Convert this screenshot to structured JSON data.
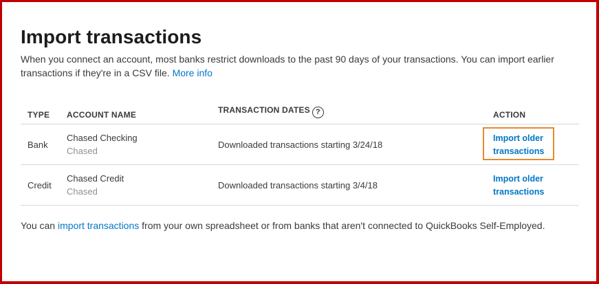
{
  "page": {
    "title": "Import transactions",
    "intro_text": "When you connect an account, most banks restrict downloads to the past 90 days of your transactions. You can import earlier transactions if they're in a CSV file.",
    "more_info_link": "More info"
  },
  "table": {
    "headers": {
      "type": "TYPE",
      "account_name": "ACCOUNT NAME",
      "transaction_dates": "TRANSACTION DATES",
      "action": "ACTION"
    },
    "help_icon_glyph": "?",
    "rows": [
      {
        "type": "Bank",
        "account_name": "Chased Checking",
        "account_institution": "Chased",
        "dates": "Downloaded transactions starting 3/24/18",
        "action_label": "Import older transactions"
      },
      {
        "type": "Credit",
        "account_name": "Chased Credit",
        "account_institution": "Chased",
        "dates": "Downloaded transactions starting 3/4/18",
        "action_label": "Import older transactions"
      }
    ]
  },
  "footer": {
    "prefix": "You can",
    "link": "import transactions",
    "suffix": "from your own spreadsheet or from banks that aren't connected to QuickBooks Self-Employed."
  },
  "colors": {
    "link": "#0077c5",
    "frame_border": "#c00000",
    "highlight_border": "#e58a2e"
  },
  "icons": {
    "help": "help-circle-icon"
  }
}
